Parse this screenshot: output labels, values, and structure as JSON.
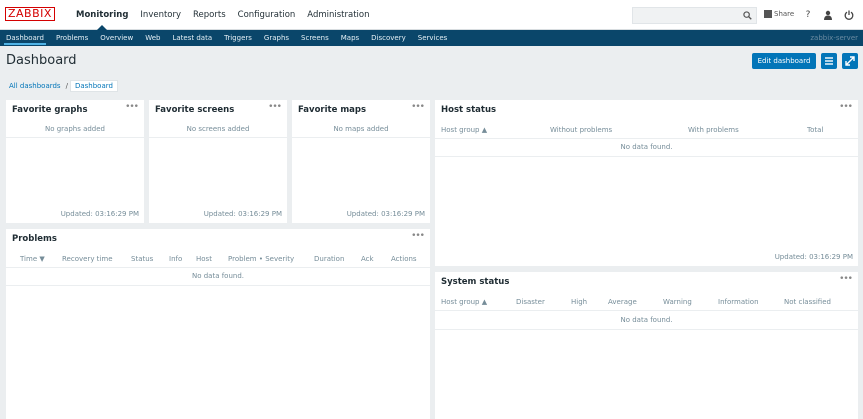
{
  "app": {
    "logo": "ZABBIX",
    "server_name": "zabbix-server"
  },
  "main_nav": [
    "Monitoring",
    "Inventory",
    "Reports",
    "Configuration",
    "Administration"
  ],
  "main_nav_active": "Monitoring",
  "top_right": {
    "share_label": "Share",
    "help_label": "?"
  },
  "sub_nav": [
    "Dashboard",
    "Problems",
    "Overview",
    "Web",
    "Latest data",
    "Triggers",
    "Graphs",
    "Screens",
    "Maps",
    "Discovery",
    "Services"
  ],
  "sub_nav_active": "Dashboard",
  "header": {
    "title": "Dashboard",
    "edit_button": "Edit dashboard"
  },
  "breadcrumb": {
    "root": "All dashboards",
    "separator": "/",
    "current": "Dashboard"
  },
  "widgets": {
    "fav_graphs": {
      "title": "Favorite graphs",
      "empty": "No graphs added",
      "updated": "Updated: 03:16:29 PM"
    },
    "fav_screens": {
      "title": "Favorite screens",
      "empty": "No screens added",
      "updated": "Updated: 03:16:29 PM"
    },
    "fav_maps": {
      "title": "Favorite maps",
      "empty": "No maps added",
      "updated": "Updated: 03:16:29 PM"
    },
    "host_status": {
      "title": "Host status",
      "columns": [
        "Host group ▲",
        "Without problems",
        "With problems",
        "Total"
      ],
      "empty": "No data found.",
      "updated": "Updated: 03:16:29 PM"
    },
    "problems": {
      "title": "Problems",
      "columns": [
        "Time ▼",
        "Recovery time",
        "Status",
        "Info",
        "Host",
        "Problem • Severity",
        "Duration",
        "Ack",
        "Actions"
      ],
      "empty": "No data found."
    },
    "system_status": {
      "title": "System status",
      "columns": [
        "Host group ▲",
        "Disaster",
        "High",
        "Average",
        "Warning",
        "Information",
        "Not classified"
      ],
      "empty": "No data found."
    }
  },
  "widget_menu": "•••",
  "colors": {
    "brand": "#d40000",
    "nav_dark": "#0a466a",
    "accent": "#0275b8",
    "background": "#ebeef0"
  }
}
